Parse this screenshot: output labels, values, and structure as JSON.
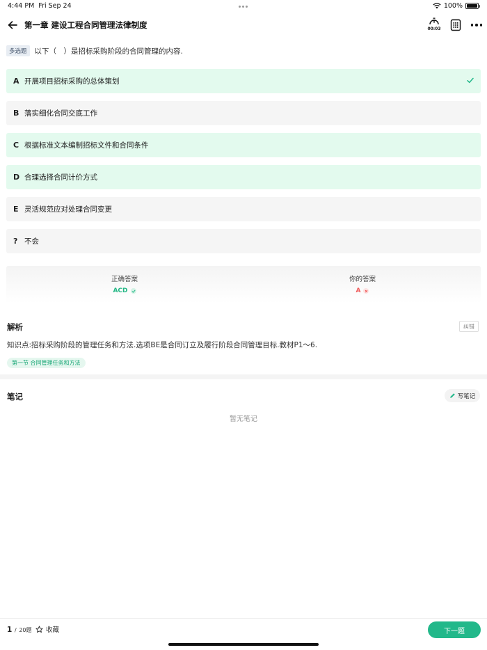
{
  "status_bar": {
    "time": "4:44 PM",
    "date": "Fri Sep 24",
    "battery": "100%"
  },
  "header": {
    "title": "第一章 建设工程合同管理法律制度",
    "timer": "00:03"
  },
  "question": {
    "type_badge": "多选题",
    "text": "以下（　）是招标采购阶段的合同管理的内容."
  },
  "options": [
    {
      "letter": "A",
      "text": "开展项目招标采购的总体策划",
      "selected": true,
      "checked": true
    },
    {
      "letter": "B",
      "text": "落实细化合同交底工作",
      "selected": false,
      "checked": false
    },
    {
      "letter": "C",
      "text": "根据标准文本编制招标文件和合同条件",
      "selected": true,
      "checked": false
    },
    {
      "letter": "D",
      "text": "合理选择合同计价方式",
      "selected": true,
      "checked": false
    },
    {
      "letter": "E",
      "text": "灵活规范应对处理合同变更",
      "selected": false,
      "checked": false
    },
    {
      "letter": "?",
      "text": "不会",
      "selected": false,
      "checked": false
    }
  ],
  "answers": {
    "correct_label": "正确答案",
    "correct_value": "ACD",
    "yours_label": "你的答案",
    "yours_value": "A"
  },
  "analysis": {
    "title": "解析",
    "report_label": "纠错",
    "text": "知识点:招标采购阶段的管理任务和方法.选项BE是合同订立及履行阶段合同管理目标.教材P1～6.",
    "section_tag": "第一节 合同管理任务和方法"
  },
  "notes": {
    "title": "笔记",
    "write_label": "写笔记",
    "empty_text": "暂无笔记"
  },
  "footer": {
    "current": "1",
    "separator": "/",
    "total": "20题",
    "favorite_label": "收藏",
    "next_label": "下一题"
  },
  "colors": {
    "accent": "#22b88a",
    "selected_bg": "#e3faee",
    "wrong": "#f05a5a"
  }
}
